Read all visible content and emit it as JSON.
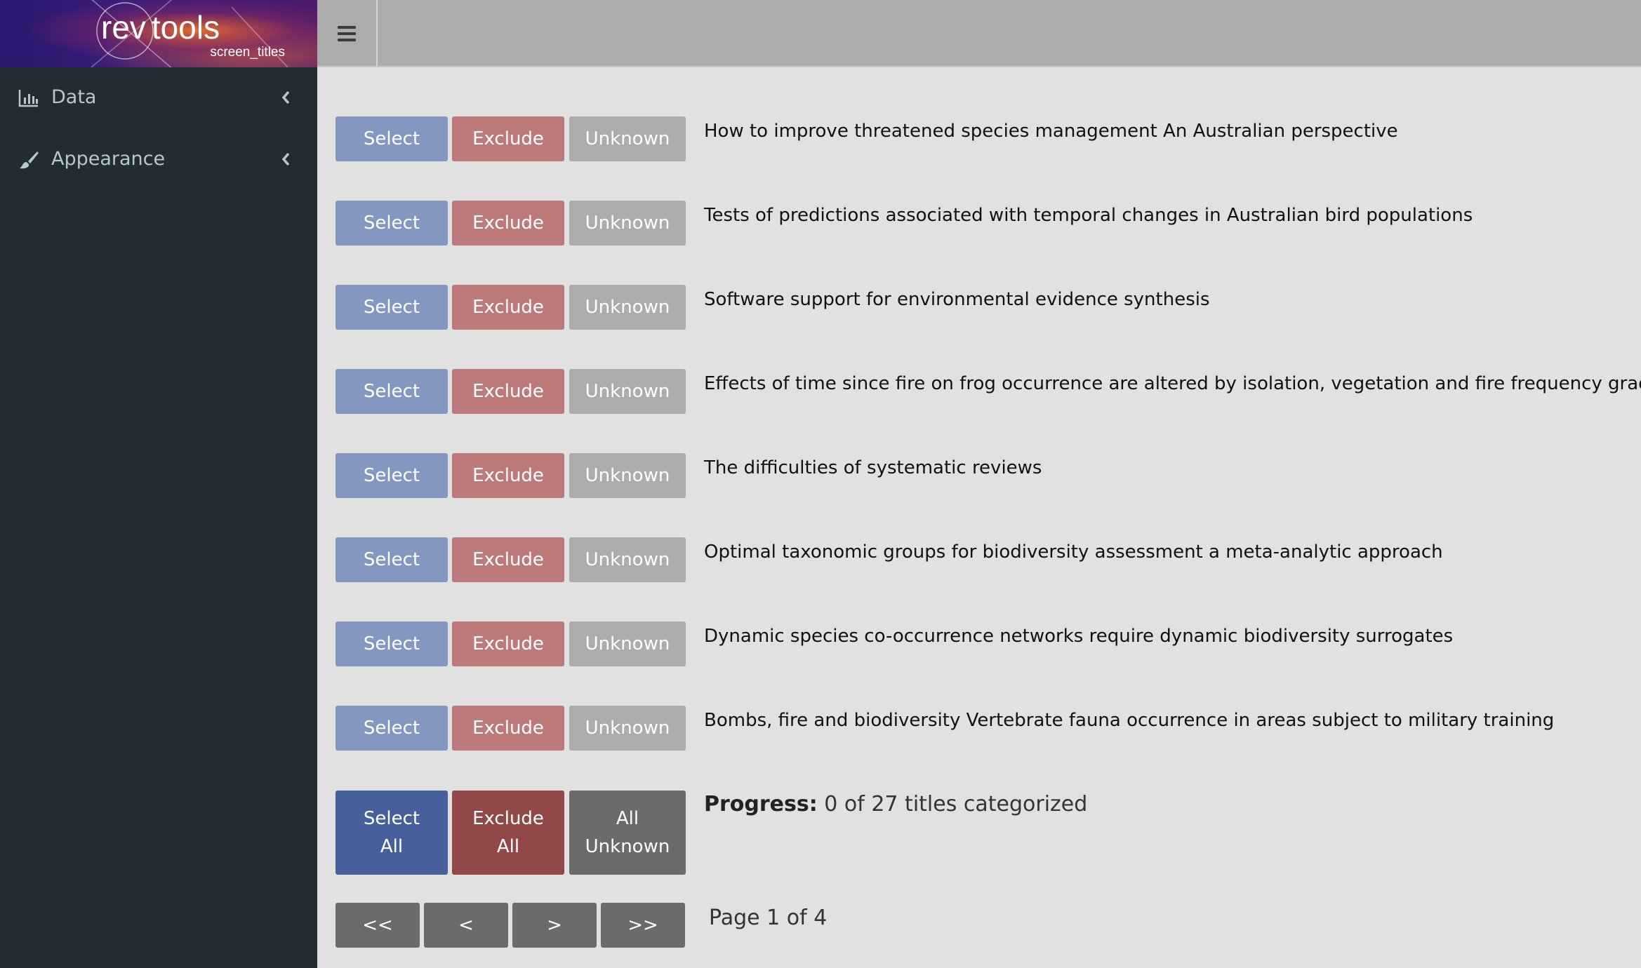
{
  "logo": {
    "word1": "rev",
    "word2": "tools",
    "subtitle": "screen_titles"
  },
  "header": {
    "toggle_icon": "hamburger-icon"
  },
  "sidebar": {
    "items": [
      {
        "label": "Data",
        "icon": "bar-chart-icon"
      },
      {
        "label": "Appearance",
        "icon": "paintbrush-icon"
      }
    ]
  },
  "labels": {
    "select": "Select",
    "exclude": "Exclude",
    "unknown": "Unknown"
  },
  "titles": [
    "How to improve threatened species management An Australian perspective",
    "Tests of predictions associated with temporal changes in Australian bird populations",
    "Software support for environmental evidence synthesis",
    "Effects of time since fire on frog occurrence are altered by isolation, vegetation and fire frequency gradients",
    "The difficulties of systematic reviews",
    "Optimal taxonomic groups for biodiversity assessment a meta-analytic approach",
    "Dynamic species co-occurrence networks require dynamic biodiversity surrogates",
    "Bombs, fire and biodiversity Vertebrate fauna occurrence in areas subject to military training"
  ],
  "bulk": {
    "select_all": [
      "Select",
      "All"
    ],
    "exclude_all": [
      "Exclude",
      "All"
    ],
    "all_unknown": [
      "All",
      "Unknown"
    ]
  },
  "progress": {
    "label": "Progress:",
    "text": "0 of 27 titles categorized"
  },
  "pager": {
    "first": "<<",
    "prev": "<",
    "next": ">",
    "last": ">>",
    "info": "Page 1 of 4"
  },
  "colors": {
    "select": "#8497c1",
    "exclude": "#bd7a7a",
    "unknown": "#acacac",
    "select_all": "#45609a",
    "exclude_all": "#924848",
    "all_unknown": "#6b6b6b",
    "sidebar": "#222d32",
    "header": "#acacac",
    "background": "#e1e1e1"
  }
}
